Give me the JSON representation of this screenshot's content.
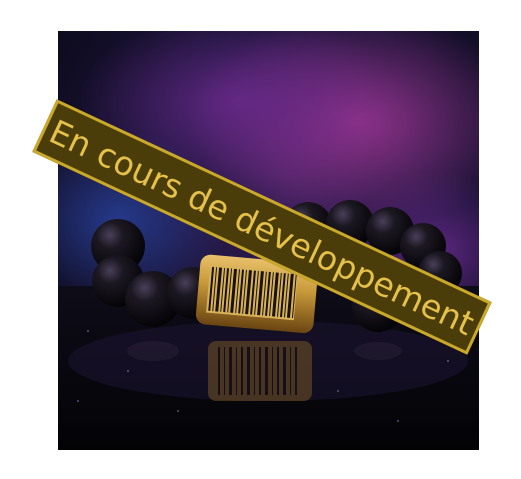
{
  "image": {
    "subject": "black-bead-bracelet-with-barcode-tube",
    "colors": {
      "background_dark": "#0d0b1e",
      "smoke_purple": "#6b2a8f",
      "smoke_magenta": "#b13a9e",
      "smoke_blue": "#2b2f7a",
      "bead": "#141218",
      "tube_gold": "#c99a3a",
      "barcode": "#1a1208"
    }
  },
  "banner": {
    "text": "En cours de développement",
    "colors": {
      "fill": "#4a3d0a",
      "border": "#c9a82a",
      "text": "#e6c14a"
    }
  }
}
